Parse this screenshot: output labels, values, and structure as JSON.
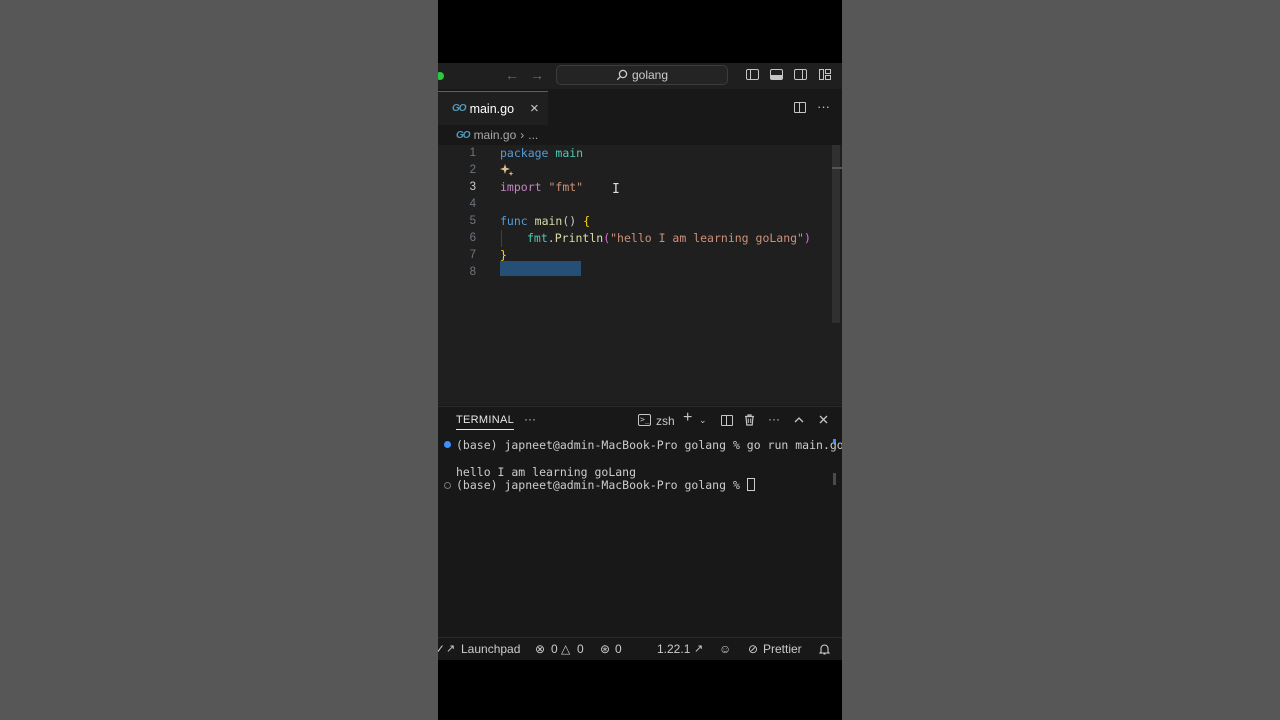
{
  "titlebar": {
    "back_icon": "arrow-left-icon",
    "forward_icon": "arrow-right-icon",
    "search_text": "golang",
    "layout_icons": [
      "toggle-primary-sidebar-icon",
      "toggle-panel-icon",
      "toggle-secondary-sidebar-icon",
      "customize-layout-icon"
    ]
  },
  "tab": {
    "label": "main.go",
    "icon": "go-icon",
    "close": "×"
  },
  "editor_actions": {
    "split": "split-editor-icon",
    "more": "···"
  },
  "breadcrumb": {
    "file": "main.go",
    "sep": "›",
    "tail": "..."
  },
  "code": {
    "line_numbers": [
      "1",
      "2",
      "3",
      "4",
      "5",
      "6",
      "7",
      "8"
    ],
    "line1": {
      "kw": "package",
      "name": "main"
    },
    "line2": {
      "icon": "sparkle-icon"
    },
    "line3": {
      "kw": "import",
      "str": "\"fmt\""
    },
    "line5": {
      "kw": "func",
      "name": "main",
      "rest": "() ",
      "brace": "{"
    },
    "line6": {
      "pkg": "fmt",
      "dot": ".",
      "fn": "Println",
      "open": "(",
      "str": "\"hello I am learning goLang\"",
      "close": ")"
    },
    "line7": {
      "brace": "}"
    }
  },
  "terminal": {
    "tab_label": "TERMINAL",
    "more": "···",
    "shell": "zsh",
    "lines": [
      "(base) japneet@admin-MacBook-Pro golang % go run main.go",
      "hello I am learning goLang",
      "(base) japneet@admin-MacBook-Pro golang % "
    ]
  },
  "statusbar": {
    "launchpad": "Launchpad",
    "errors": "0",
    "warnings": "0",
    "ports": "0",
    "go_version": "1.22.1",
    "prettier": "Prettier"
  }
}
